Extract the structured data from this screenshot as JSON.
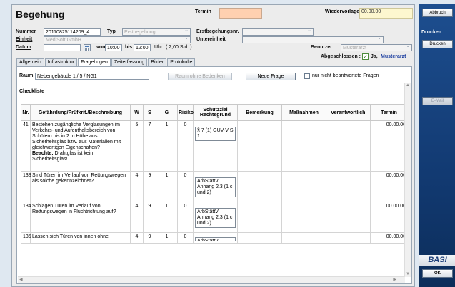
{
  "header": {
    "title": "Begehung",
    "termin_label": "Termin",
    "wiedervorlage_label": "Wiedervorlage",
    "wiedervorlage_value": "00.00.00"
  },
  "form": {
    "nummer_label": "Nummer",
    "nummer_value": "20110825114209_4",
    "typ_label": "Typ",
    "typ_value": "Erstbegehung",
    "erstbeg_label": "Erstbegehungsnr.",
    "einheit_label": "Einheit",
    "einheit_value": "MediSoft GmbH",
    "untereinheit_label": "Untereinheit",
    "datum_label": "Datum",
    "von_label": "von",
    "von_value": "10:00",
    "bis_label": "bis",
    "bis_value": "12:00",
    "uhr_label": "Uhr",
    "duration": "( 2,00 Std. )",
    "benutzer_label": "Benutzer",
    "benutzer_value": "Musterarzt",
    "abgeschlossen_label": "Abgeschlossen :",
    "abgeschlossen_value": "Ja,",
    "abgeschlossen_user": "Musterarzt"
  },
  "tabs": [
    "Allgemein",
    "Infrastruktur",
    "Fragebogen",
    "Zeiterfassung",
    "Bilder",
    "Protokolle"
  ],
  "fragebogen": {
    "raum_label": "Raum",
    "raum_value": "Nebengebäude 1 / 5 / NG1",
    "raum_ohne_btn": "Raum ohne Bedenken",
    "neue_frage_btn": "Neue Frage",
    "nur_unbeantwortet_label": "nur nicht beantwortete Fragen",
    "checkliste_label": "Checkliste"
  },
  "table": {
    "columns": [
      "Nr.",
      "Gefährdung/Prüfkrit./Beschreibung",
      "W",
      "S",
      "G",
      "Risiko",
      "Schutzziel Rechtsgrund",
      "Bemerkung",
      "Maßnahmen",
      "verantwortlich",
      "Termin"
    ],
    "rows": [
      {
        "nr": "41",
        "desc": "Bestehen zugängliche Verglasungen im Verkehrs- und Aufenthaltsbereich von Schülern bis in 2 m Höhe aus Sicherheitsglas bzw. aus Materialien mit gleichwertigen Eigenschaften?",
        "note_bold": "Beachte:",
        "note": " Drahtglas ist kein Sicherheitsglas!",
        "w": "5",
        "s": "7",
        "g": "1",
        "risiko": "0",
        "schutzziel": "§ 7 (1) GUV-V S 1",
        "termin": "00.00.00"
      },
      {
        "nr": "133",
        "desc": "Sind Türen im Verlauf von Rettungswegen als solche gekennzeichnet?",
        "note_bold": "",
        "note": "",
        "w": "4",
        "s": "9",
        "g": "1",
        "risiko": "0",
        "schutzziel": "ArbStättV, Anhang 2.3 (1 c und 2)",
        "termin": "00.00.00"
      },
      {
        "nr": "134",
        "desc": "Schlagen Türen im Verlauf von Rettungswegen in Fluchtrichtung auf?",
        "note_bold": "",
        "note": "",
        "w": "4",
        "s": "9",
        "g": "1",
        "risiko": "0",
        "schutzziel": "ArbStättV, Anhang 2.3 (1 c und 2)",
        "termin": "00.00.00"
      },
      {
        "nr": "135",
        "desc": "Lassen sich Türen von innen ohne",
        "note_bold": "",
        "note": "",
        "w": "4",
        "s": "9",
        "g": "1",
        "risiko": "0",
        "schutzziel": "ArbStättV",
        "termin": "00.00.00"
      }
    ]
  },
  "sidebar": {
    "abbruch_btn": "Abbruch",
    "drucken_label": "Drucken",
    "drucken_btn": "Drucken",
    "email_btn": "E-Mail",
    "logo_text": "BASI",
    "ok_btn": "OK"
  },
  "colors": {
    "termin_field": "#ffd0b0",
    "wiedervorlage_field": "#fdf7cf",
    "sidebar": "#123a72"
  }
}
